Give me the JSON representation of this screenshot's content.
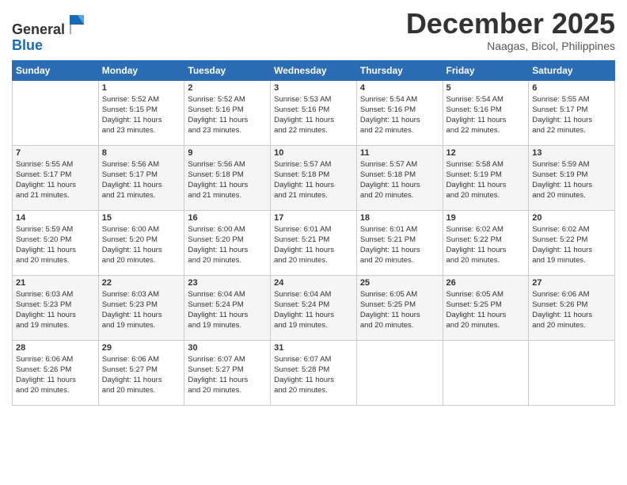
{
  "header": {
    "logo_line1": "General",
    "logo_line2": "Blue",
    "month": "December 2025",
    "location": "Naagas, Bicol, Philippines"
  },
  "days_of_week": [
    "Sunday",
    "Monday",
    "Tuesday",
    "Wednesday",
    "Thursday",
    "Friday",
    "Saturday"
  ],
  "weeks": [
    [
      {
        "day": "",
        "info": ""
      },
      {
        "day": "1",
        "info": "Sunrise: 5:52 AM\nSunset: 5:15 PM\nDaylight: 11 hours\nand 23 minutes."
      },
      {
        "day": "2",
        "info": "Sunrise: 5:52 AM\nSunset: 5:16 PM\nDaylight: 11 hours\nand 23 minutes."
      },
      {
        "day": "3",
        "info": "Sunrise: 5:53 AM\nSunset: 5:16 PM\nDaylight: 11 hours\nand 22 minutes."
      },
      {
        "day": "4",
        "info": "Sunrise: 5:54 AM\nSunset: 5:16 PM\nDaylight: 11 hours\nand 22 minutes."
      },
      {
        "day": "5",
        "info": "Sunrise: 5:54 AM\nSunset: 5:16 PM\nDaylight: 11 hours\nand 22 minutes."
      },
      {
        "day": "6",
        "info": "Sunrise: 5:55 AM\nSunset: 5:17 PM\nDaylight: 11 hours\nand 22 minutes."
      }
    ],
    [
      {
        "day": "7",
        "info": "Sunrise: 5:55 AM\nSunset: 5:17 PM\nDaylight: 11 hours\nand 21 minutes."
      },
      {
        "day": "8",
        "info": "Sunrise: 5:56 AM\nSunset: 5:17 PM\nDaylight: 11 hours\nand 21 minutes."
      },
      {
        "day": "9",
        "info": "Sunrise: 5:56 AM\nSunset: 5:18 PM\nDaylight: 11 hours\nand 21 minutes."
      },
      {
        "day": "10",
        "info": "Sunrise: 5:57 AM\nSunset: 5:18 PM\nDaylight: 11 hours\nand 21 minutes."
      },
      {
        "day": "11",
        "info": "Sunrise: 5:57 AM\nSunset: 5:18 PM\nDaylight: 11 hours\nand 20 minutes."
      },
      {
        "day": "12",
        "info": "Sunrise: 5:58 AM\nSunset: 5:19 PM\nDaylight: 11 hours\nand 20 minutes."
      },
      {
        "day": "13",
        "info": "Sunrise: 5:59 AM\nSunset: 5:19 PM\nDaylight: 11 hours\nand 20 minutes."
      }
    ],
    [
      {
        "day": "14",
        "info": "Sunrise: 5:59 AM\nSunset: 5:20 PM\nDaylight: 11 hours\nand 20 minutes."
      },
      {
        "day": "15",
        "info": "Sunrise: 6:00 AM\nSunset: 5:20 PM\nDaylight: 11 hours\nand 20 minutes."
      },
      {
        "day": "16",
        "info": "Sunrise: 6:00 AM\nSunset: 5:20 PM\nDaylight: 11 hours\nand 20 minutes."
      },
      {
        "day": "17",
        "info": "Sunrise: 6:01 AM\nSunset: 5:21 PM\nDaylight: 11 hours\nand 20 minutes."
      },
      {
        "day": "18",
        "info": "Sunrise: 6:01 AM\nSunset: 5:21 PM\nDaylight: 11 hours\nand 20 minutes."
      },
      {
        "day": "19",
        "info": "Sunrise: 6:02 AM\nSunset: 5:22 PM\nDaylight: 11 hours\nand 20 minutes."
      },
      {
        "day": "20",
        "info": "Sunrise: 6:02 AM\nSunset: 5:22 PM\nDaylight: 11 hours\nand 19 minutes."
      }
    ],
    [
      {
        "day": "21",
        "info": "Sunrise: 6:03 AM\nSunset: 5:23 PM\nDaylight: 11 hours\nand 19 minutes."
      },
      {
        "day": "22",
        "info": "Sunrise: 6:03 AM\nSunset: 5:23 PM\nDaylight: 11 hours\nand 19 minutes."
      },
      {
        "day": "23",
        "info": "Sunrise: 6:04 AM\nSunset: 5:24 PM\nDaylight: 11 hours\nand 19 minutes."
      },
      {
        "day": "24",
        "info": "Sunrise: 6:04 AM\nSunset: 5:24 PM\nDaylight: 11 hours\nand 19 minutes."
      },
      {
        "day": "25",
        "info": "Sunrise: 6:05 AM\nSunset: 5:25 PM\nDaylight: 11 hours\nand 20 minutes."
      },
      {
        "day": "26",
        "info": "Sunrise: 6:05 AM\nSunset: 5:25 PM\nDaylight: 11 hours\nand 20 minutes."
      },
      {
        "day": "27",
        "info": "Sunrise: 6:06 AM\nSunset: 5:26 PM\nDaylight: 11 hours\nand 20 minutes."
      }
    ],
    [
      {
        "day": "28",
        "info": "Sunrise: 6:06 AM\nSunset: 5:26 PM\nDaylight: 11 hours\nand 20 minutes."
      },
      {
        "day": "29",
        "info": "Sunrise: 6:06 AM\nSunset: 5:27 PM\nDaylight: 11 hours\nand 20 minutes."
      },
      {
        "day": "30",
        "info": "Sunrise: 6:07 AM\nSunset: 5:27 PM\nDaylight: 11 hours\nand 20 minutes."
      },
      {
        "day": "31",
        "info": "Sunrise: 6:07 AM\nSunset: 5:28 PM\nDaylight: 11 hours\nand 20 minutes."
      },
      {
        "day": "",
        "info": ""
      },
      {
        "day": "",
        "info": ""
      },
      {
        "day": "",
        "info": ""
      }
    ]
  ]
}
